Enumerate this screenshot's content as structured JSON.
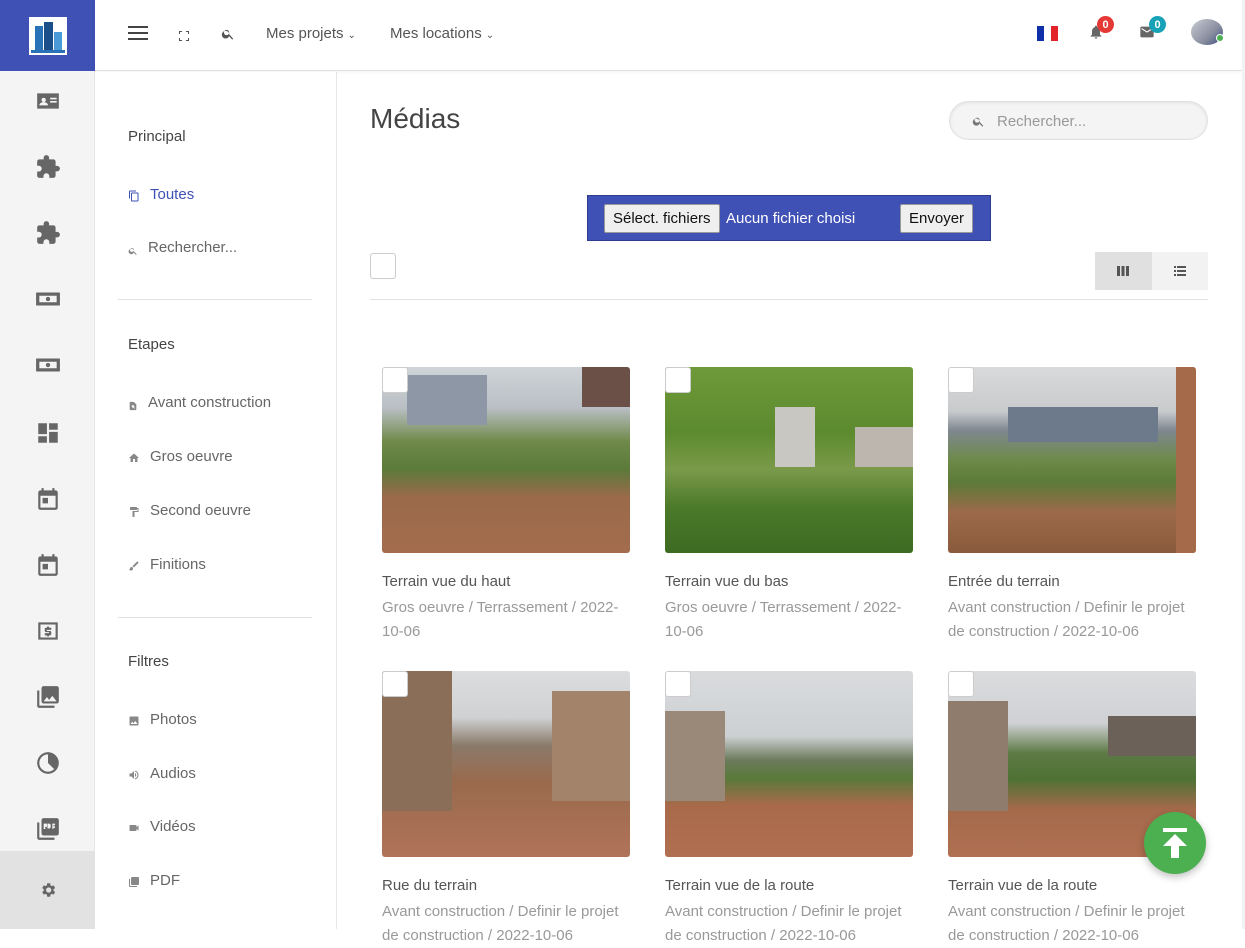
{
  "topbar": {
    "projects_label": "Mes projets",
    "rentals_label": "Mes locations",
    "notifications_count": "0",
    "messages_count": "0"
  },
  "sidebar": {
    "section_main": "Principal",
    "all_label": "Toutes",
    "search_label": "Rechercher...",
    "section_steps": "Etapes",
    "steps": [
      "Avant construction",
      "Gros oeuvre",
      "Second oeuvre",
      "Finitions"
    ],
    "section_filters": "Filtres",
    "filters": [
      "Photos",
      "Audios",
      "Vidéos",
      "PDF"
    ]
  },
  "main": {
    "title": "Médias",
    "search_placeholder": "Rechercher...",
    "upload": {
      "choose_label": "Sélect. fichiers",
      "no_file_label": "Aucun fichier choisi",
      "send_label": "Envoyer"
    }
  },
  "media": [
    {
      "title": "Terrain vue du haut",
      "meta": "Gros oeuvre / Terrassement / 2022-10-06"
    },
    {
      "title": "Terrain vue du bas",
      "meta": "Gros oeuvre / Terrassement / 2022-10-06"
    },
    {
      "title": "Entrée du terrain",
      "meta": "Avant construction / Definir le projet de construction / 2022-10-06"
    },
    {
      "title": "Rue du terrain",
      "meta": "Avant construction / Definir le projet de construction / 2022-10-06"
    },
    {
      "title": "Terrain vue de la route",
      "meta": "Avant construction / Definir le projet de construction / 2022-10-06"
    },
    {
      "title": "Terrain vue de la route",
      "meta": "Avant construction / Definir le projet de construction / 2022-10-06"
    }
  ],
  "colors": {
    "brand": "#3f51b5",
    "accent_green": "#4caf50",
    "badge_red": "#e53935",
    "badge_teal": "#17a2b8"
  }
}
